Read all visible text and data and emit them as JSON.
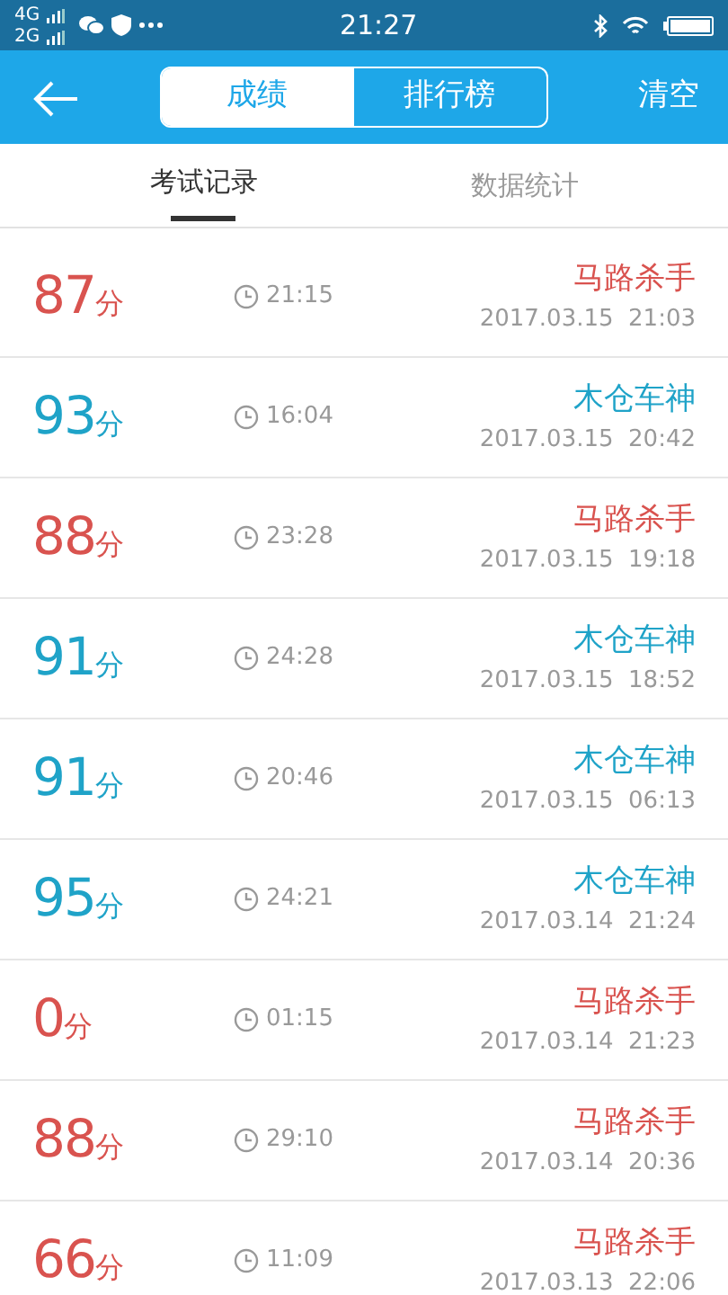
{
  "status_bar": {
    "networks": [
      "4G",
      "2G"
    ],
    "time": "21:27"
  },
  "header": {
    "segments": [
      {
        "label": "成绩",
        "selected": true
      },
      {
        "label": "排行榜",
        "selected": false
      }
    ],
    "action": "清空"
  },
  "tabs": [
    {
      "label": "考试记录",
      "selected": true
    },
    {
      "label": "数据统计",
      "selected": false
    }
  ],
  "records": [
    {
      "score": "87",
      "unit": "分",
      "duration": "21:15",
      "user": "马路杀手",
      "date": "2017.03.15  21:03",
      "color": "#d9534f"
    },
    {
      "score": "93",
      "unit": "分",
      "duration": "16:04",
      "user": "木仓车神",
      "date": "2017.03.15  20:42",
      "color": "#1fa3c8"
    },
    {
      "score": "88",
      "unit": "分",
      "duration": "23:28",
      "user": "马路杀手",
      "date": "2017.03.15  19:18",
      "color": "#d9534f"
    },
    {
      "score": "91",
      "unit": "分",
      "duration": "24:28",
      "user": "木仓车神",
      "date": "2017.03.15  18:52",
      "color": "#1fa3c8"
    },
    {
      "score": "91",
      "unit": "分",
      "duration": "20:46",
      "user": "木仓车神",
      "date": "2017.03.15  06:13",
      "color": "#1fa3c8"
    },
    {
      "score": "95",
      "unit": "分",
      "duration": "24:21",
      "user": "木仓车神",
      "date": "2017.03.14  21:24",
      "color": "#1fa3c8"
    },
    {
      "score": "0",
      "unit": "分",
      "duration": "01:15",
      "user": "马路杀手",
      "date": "2017.03.14  21:23",
      "color": "#d9534f"
    },
    {
      "score": "88",
      "unit": "分",
      "duration": "29:10",
      "user": "马路杀手",
      "date": "2017.03.14  20:36",
      "color": "#d9534f"
    },
    {
      "score": "66",
      "unit": "分",
      "duration": "11:09",
      "user": "马路杀手",
      "date": "2017.03.13  22:06",
      "color": "#d9534f"
    }
  ]
}
